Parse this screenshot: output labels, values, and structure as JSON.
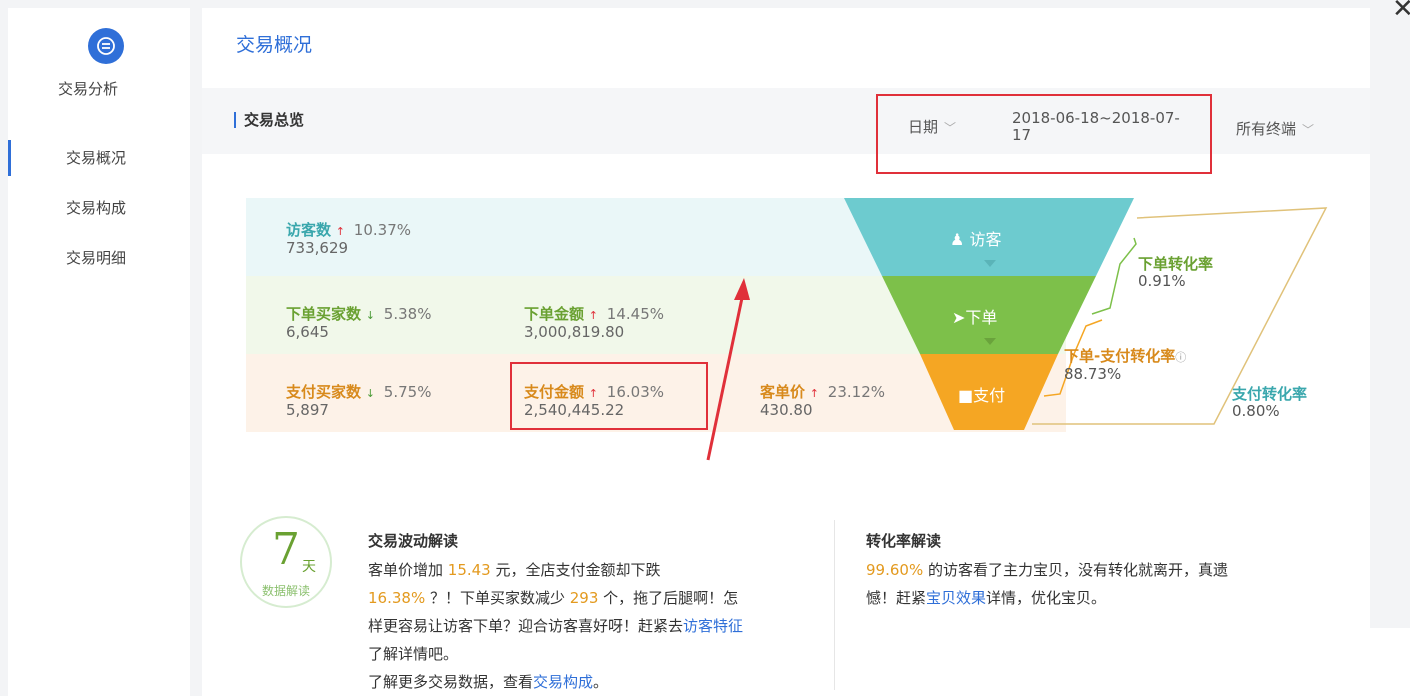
{
  "sidebar": {
    "title": "交易分析",
    "items": [
      {
        "label": "交易概况",
        "active": true
      },
      {
        "label": "交易构成",
        "active": false
      },
      {
        "label": "交易明细",
        "active": false
      }
    ]
  },
  "header": {
    "title": "交易概况",
    "section_title": "交易总览",
    "date_label": "日期",
    "date_value": "2018-06-18~2018-07-17",
    "terminal_label": "所有终端"
  },
  "metrics": {
    "visitors": {
      "name": "访客数",
      "change": "10.37%",
      "direction": "up",
      "value": "733,629"
    },
    "order_buyers": {
      "name": "下单买家数",
      "change": "5.38%",
      "direction": "down",
      "value": "6,645"
    },
    "order_amount": {
      "name": "下单金额",
      "change": "14.45%",
      "direction": "up",
      "value": "3,000,819.80"
    },
    "pay_buyers": {
      "name": "支付买家数",
      "change": "5.75%",
      "direction": "down",
      "value": "5,897"
    },
    "pay_amount": {
      "name": "支付金额",
      "change": "16.03%",
      "direction": "up",
      "value": "2,540,445.22"
    },
    "unit_price": {
      "name": "客单价",
      "change": "23.12%",
      "direction": "up",
      "value": "430.80"
    }
  },
  "funnel": {
    "stages": [
      "访客",
      "下单",
      "支付"
    ],
    "colors": {
      "visit": "#6dcbcf",
      "order": "#7dc04a",
      "pay": "#f5a623"
    },
    "rates": {
      "order_rate": {
        "name": "下单转化率",
        "value": "0.91%"
      },
      "order_pay_rate": {
        "name": "下单-支付转化率",
        "value": "88.73%"
      },
      "pay_rate": {
        "name": "支付转化率",
        "value": "0.80%"
      }
    }
  },
  "interpretation": {
    "badge_num": "7",
    "badge_unit": "天",
    "badge_text": "数据解读",
    "fluct_title": "交易波动解读",
    "fluct_l1a": "客单价增加 ",
    "fluct_n1": "15.43",
    "fluct_l1b": " 元，全店支付金额却下跌",
    "fluct_n2": "16.38%",
    "fluct_l2a": " ？！下单买家数减少 ",
    "fluct_n3": "293",
    "fluct_l2b": " 个，拖了后腿啊！怎",
    "fluct_l3a": "样更容易让访客下单？迎合访客喜好呀！赶紧去",
    "fluct_link1": "访客特征",
    "fluct_l4": "了解详情吧。",
    "fluct_l5a": "了解更多交易数据，查看",
    "fluct_link2": "交易构成",
    "fluct_l5b": "。",
    "conv_title": "转化率解读",
    "conv_n1": "99.60%",
    "conv_l1": " 的访客看了主力宝贝，没有转化就离开，真遗",
    "conv_l2a": "憾！赶紧",
    "conv_link": "宝贝效果",
    "conv_l2b": "详情，优化宝贝。"
  }
}
